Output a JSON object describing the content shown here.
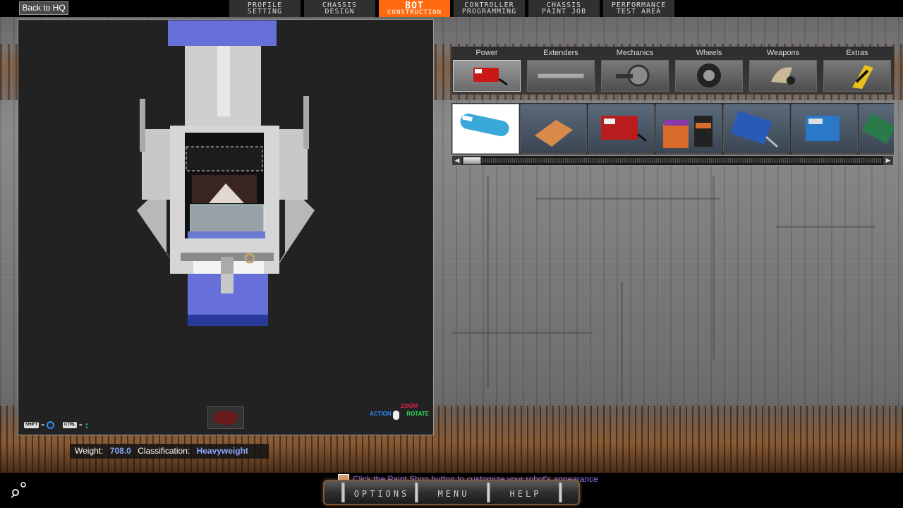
{
  "nav": {
    "back_label": "Back to HQ",
    "tabs": [
      {
        "line1": "PROFILE",
        "line2": "SETTING"
      },
      {
        "line1": "CHASSIS",
        "line2": "DESIGN"
      },
      {
        "line1": "BOT",
        "line2": "CONSTRUCTION",
        "active": true
      },
      {
        "line1": "CONTROLLER",
        "line2": "PROGRAMMING"
      },
      {
        "line1": "CHASSIS",
        "line2": "PAINT JOB"
      },
      {
        "line1": "PERFORMANCE",
        "line2": "TEST AREA"
      }
    ]
  },
  "viewport": {
    "hints": {
      "shift_key": "SHIFT",
      "ctrl_key": "CTRL",
      "eq": "=",
      "action": "ACTION",
      "zoom": "ZOOM",
      "rotate": "ROTATE"
    }
  },
  "categories": [
    {
      "label": "Power",
      "icon": "battery-icon",
      "active": true
    },
    {
      "label": "Extenders",
      "icon": "extender-bar-icon"
    },
    {
      "label": "Mechanics",
      "icon": "motor-icon"
    },
    {
      "label": "Wheels",
      "icon": "wheel-icon"
    },
    {
      "label": "Weapons",
      "icon": "blade-icon"
    },
    {
      "label": "Extras",
      "icon": "hazard-plate-icon"
    }
  ],
  "parts": [
    {
      "icon": "blue-canister-battery-icon",
      "selected": true
    },
    {
      "icon": "orange-battery-pack-icon"
    },
    {
      "icon": "red-battery-icon"
    },
    {
      "icon": "battery-cells-icon"
    },
    {
      "icon": "blue-pwm-battery-icon"
    },
    {
      "icon": "blue-speed-controller-icon"
    },
    {
      "icon": "green-circuit-board-icon"
    }
  ],
  "stats": {
    "weight_label": "Weight:",
    "weight_value": "708.0",
    "class_label": "Classification:",
    "class_value": "Heavyweight"
  },
  "bottom": {
    "tip": "Click the Paint Shop button to customize your robot's appearance",
    "options_label": "OPTIONS",
    "menu_label": "MENU",
    "help_label": "HELP"
  },
  "colors": {
    "active_tab": "#ff6a10",
    "stat_value": "#8aa8ff",
    "tip_text": "#8c78ff",
    "chassis_blue": "#6670d8"
  }
}
